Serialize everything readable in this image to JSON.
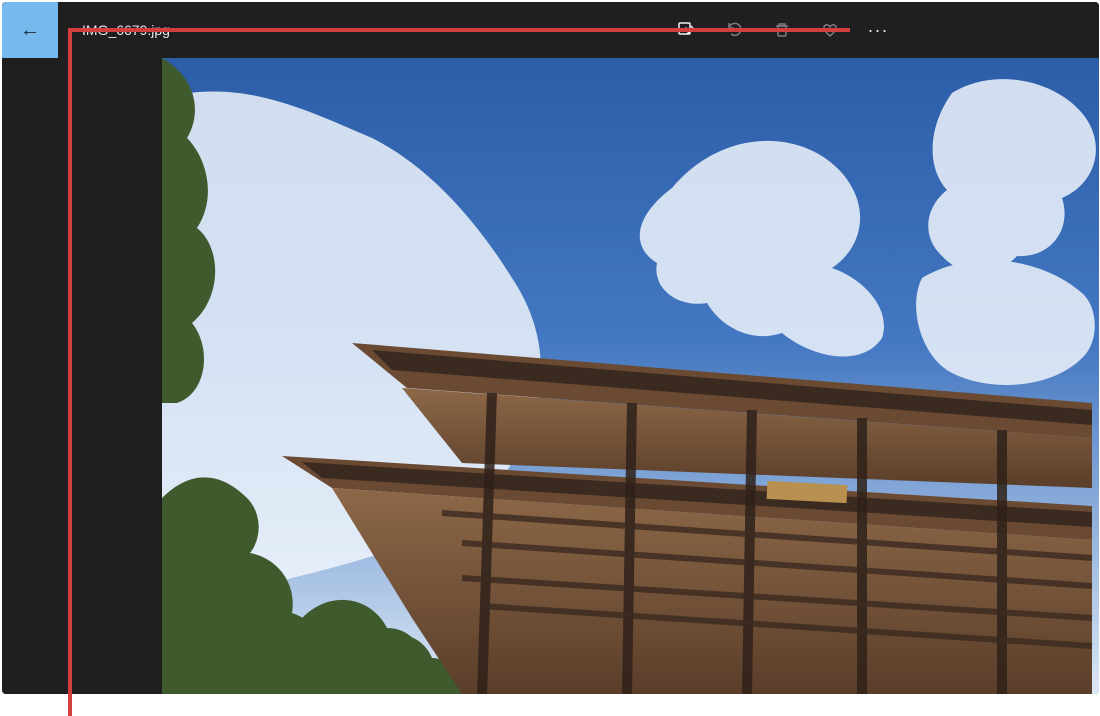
{
  "window": {
    "back_icon": "←",
    "title": "IMG_6679.jpg"
  },
  "toolbar": {
    "edit_icon": "photo-edit-icon",
    "rotate_icon": "rotate-icon",
    "delete_icon": "trash-icon",
    "favorite_icon": "heart-icon",
    "more_label": "···"
  },
  "colors": {
    "back_button": "#76b9ed",
    "background": "#1f1f1f",
    "callout": "#d33f3f"
  }
}
